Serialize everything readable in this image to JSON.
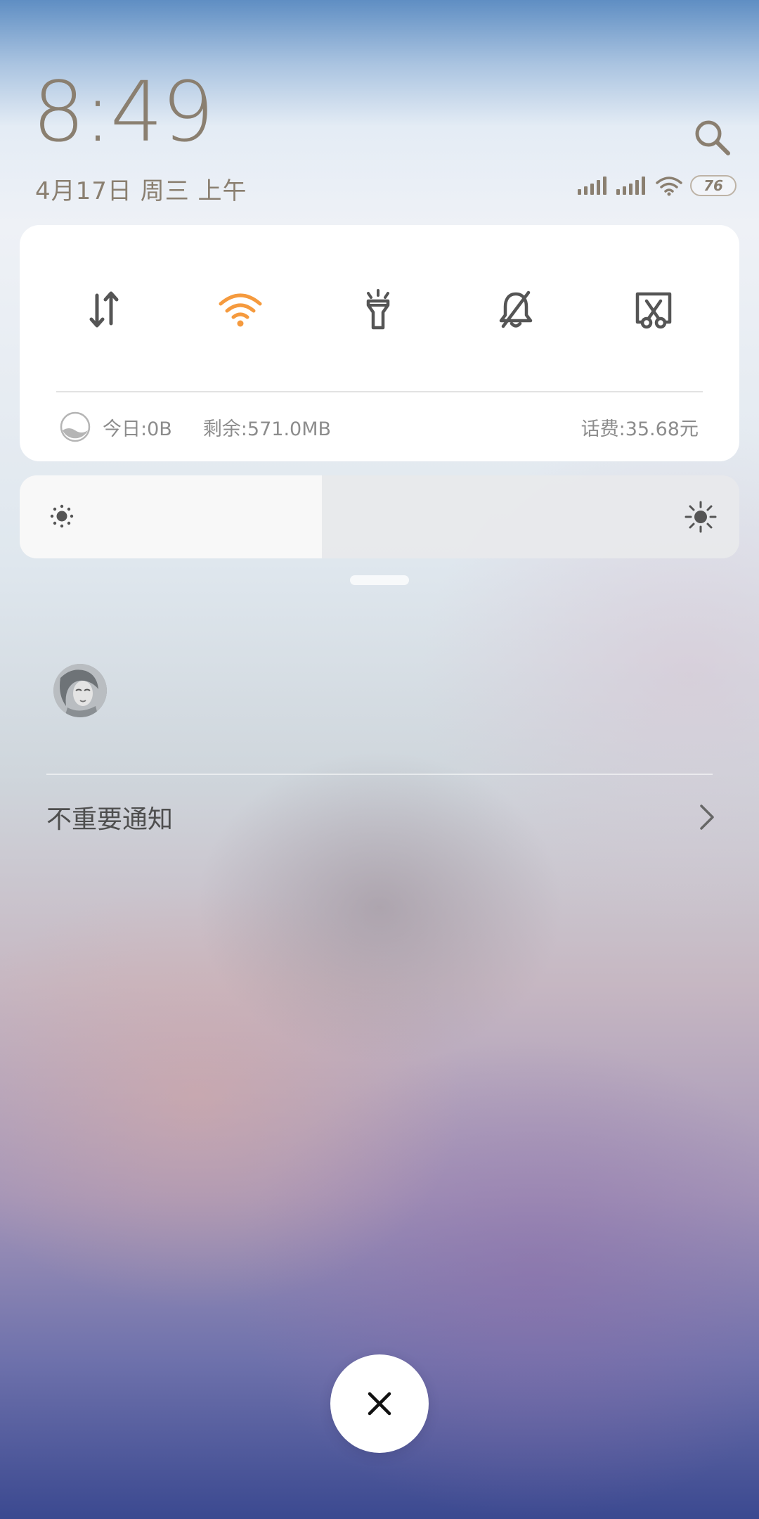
{
  "header": {
    "time": "8:49",
    "date": "4月17日 周三 上午",
    "battery_level": "76",
    "search_icon": "search-icon"
  },
  "quick_settings": {
    "toggles": [
      {
        "name": "mobile-data",
        "icon": "mobile-data-icon",
        "active": false
      },
      {
        "name": "wifi",
        "icon": "wifi-icon",
        "active": true
      },
      {
        "name": "flashlight",
        "icon": "flashlight-icon",
        "active": false
      },
      {
        "name": "mute",
        "icon": "bell-off-icon",
        "active": false
      },
      {
        "name": "screenshot",
        "icon": "screenshot-icon",
        "active": false
      }
    ],
    "data_usage": {
      "today": "今日:0B",
      "remaining": "剩余:571.0MB",
      "bill": "话费:35.68元"
    }
  },
  "brightness": {
    "level_fraction": 0.42
  },
  "notifications": {
    "unimportant_label": "不重要通知"
  },
  "colors": {
    "accent": "#f59a3e",
    "icon_default": "#555555",
    "header_text": "#8a7f70"
  },
  "clear_all_icon": "close-icon"
}
